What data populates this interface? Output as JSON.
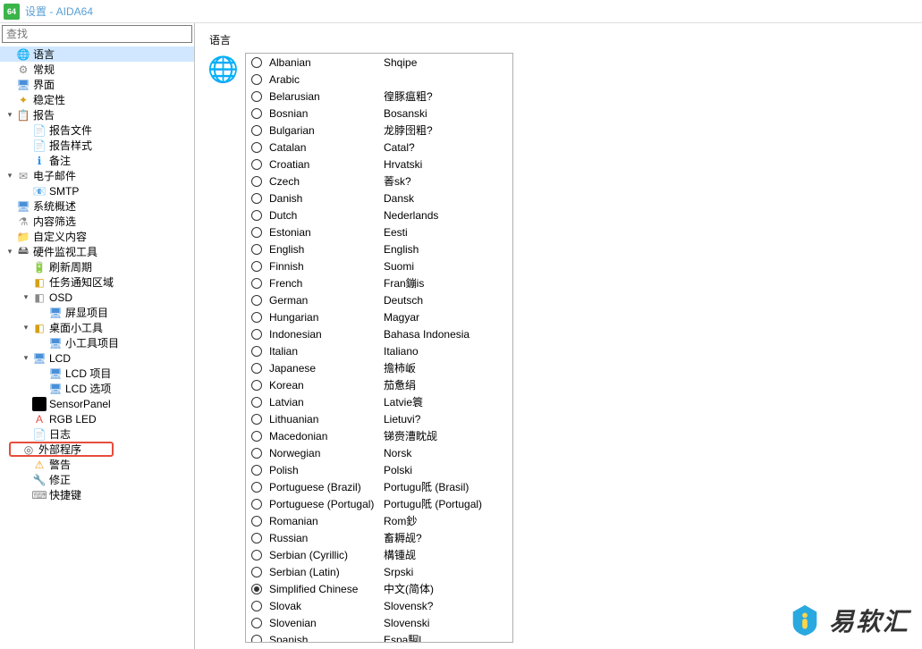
{
  "titlebar": {
    "icon_text": "64",
    "title": "设置 - AIDA64"
  },
  "search": {
    "placeholder": "查找"
  },
  "tree": [
    {
      "id": "language",
      "label": "语言",
      "icon": "🌐",
      "cls": "ic-globe",
      "indent": 0,
      "selected": true
    },
    {
      "id": "general",
      "label": "常规",
      "icon": "⚙",
      "cls": "ic-gear",
      "indent": 0
    },
    {
      "id": "interface",
      "label": "界面",
      "icon": "🖥",
      "cls": "ic-window",
      "indent": 0
    },
    {
      "id": "stability",
      "label": "稳定性",
      "icon": "✦",
      "cls": "ic-stable",
      "indent": 0
    },
    {
      "id": "report",
      "label": "报告",
      "icon": "📋",
      "cls": "ic-report",
      "indent": 0,
      "expander": "▾"
    },
    {
      "id": "report-file",
      "label": "报告文件",
      "icon": "📄",
      "cls": "ic-file",
      "indent": 1
    },
    {
      "id": "report-style",
      "label": "报告样式",
      "icon": "📄",
      "cls": "ic-file",
      "indent": 1
    },
    {
      "id": "remarks",
      "label": "备注",
      "icon": "ℹ",
      "cls": "ic-info",
      "indent": 1
    },
    {
      "id": "email",
      "label": "电子邮件",
      "icon": "✉",
      "cls": "ic-mail",
      "indent": 0,
      "expander": "▾"
    },
    {
      "id": "smtp",
      "label": "SMTP",
      "icon": "📧",
      "cls": "ic-mail",
      "indent": 1
    },
    {
      "id": "sysoverview",
      "label": "系统概述",
      "icon": "🖥",
      "cls": "ic-monitor",
      "indent": 0
    },
    {
      "id": "content-filter",
      "label": "内容筛选",
      "icon": "⚗",
      "cls": "ic-filter",
      "indent": 0
    },
    {
      "id": "custom",
      "label": "自定义内容",
      "icon": "📁",
      "cls": "ic-custom",
      "indent": 0
    },
    {
      "id": "hwmon",
      "label": "硬件监视工具",
      "icon": "🖴",
      "cls": "ic-hardware",
      "indent": 0,
      "expander": "▾"
    },
    {
      "id": "refresh",
      "label": "刷新周期",
      "icon": "🔋",
      "cls": "ic-battery",
      "indent": 1
    },
    {
      "id": "tray",
      "label": "任务通知区域",
      "icon": "◧",
      "cls": "ic-notify",
      "indent": 1
    },
    {
      "id": "osd",
      "label": "OSD",
      "icon": "◧",
      "cls": "ic-osd",
      "indent": 1,
      "expander": "▾"
    },
    {
      "id": "osd-item",
      "label": "屏显项目",
      "icon": "🖥",
      "cls": "ic-monitor",
      "indent": 2
    },
    {
      "id": "gadget",
      "label": "桌面小工具",
      "icon": "◧",
      "cls": "ic-widget",
      "indent": 1,
      "expander": "▾"
    },
    {
      "id": "gadget-item",
      "label": "小工具项目",
      "icon": "🖥",
      "cls": "ic-monitor",
      "indent": 2
    },
    {
      "id": "lcd",
      "label": "LCD",
      "icon": "🖥",
      "cls": "ic-lcd",
      "indent": 1,
      "expander": "▾"
    },
    {
      "id": "lcd-item",
      "label": "LCD 项目",
      "icon": "🖥",
      "cls": "ic-monitor",
      "indent": 2
    },
    {
      "id": "lcd-opt",
      "label": "LCD 选项",
      "icon": "🖥",
      "cls": "ic-monitor",
      "indent": 2
    },
    {
      "id": "sensorpanel",
      "label": "SensorPanel",
      "icon": "◼",
      "cls": "ic-sensor",
      "indent": 1
    },
    {
      "id": "rgbled",
      "label": "RGB LED",
      "icon": "A",
      "cls": "ic-rgb",
      "indent": 1
    },
    {
      "id": "log",
      "label": "日志",
      "icon": "📄",
      "cls": "ic-log",
      "indent": 1
    },
    {
      "id": "external",
      "label": "外部程序",
      "icon": "◎",
      "cls": "ic-ext",
      "indent": 1,
      "highlighted": true
    },
    {
      "id": "warning",
      "label": "警告",
      "icon": "⚠",
      "cls": "ic-warn",
      "indent": 1
    },
    {
      "id": "fix",
      "label": "修正",
      "icon": "🔧",
      "cls": "ic-fix",
      "indent": 1
    },
    {
      "id": "shortcut",
      "label": "快捷键",
      "icon": "⌨",
      "cls": "ic-key",
      "indent": 1
    }
  ],
  "main": {
    "section_title": "语言",
    "languages": [
      {
        "en": "Albanian",
        "native": "Shqipe"
      },
      {
        "en": "Arabic",
        "native": ""
      },
      {
        "en": "Belarusian",
        "native": "徨豚瘟粗?"
      },
      {
        "en": "Bosnian",
        "native": "Bosanski"
      },
      {
        "en": "Bulgarian",
        "native": "龙脖囹粗?"
      },
      {
        "en": "Catalan",
        "native": "Catal?"
      },
      {
        "en": "Croatian",
        "native": "Hrvatski"
      },
      {
        "en": "Czech",
        "native": "萫sk?"
      },
      {
        "en": "Danish",
        "native": "Dansk"
      },
      {
        "en": "Dutch",
        "native": "Nederlands"
      },
      {
        "en": "Estonian",
        "native": "Eesti"
      },
      {
        "en": "English",
        "native": "English"
      },
      {
        "en": "Finnish",
        "native": "Suomi"
      },
      {
        "en": "French",
        "native": "Fran鏰is"
      },
      {
        "en": "German",
        "native": "Deutsch"
      },
      {
        "en": "Hungarian",
        "native": "Magyar"
      },
      {
        "en": "Indonesian",
        "native": "Bahasa Indonesia"
      },
      {
        "en": "Italian",
        "native": "Italiano"
      },
      {
        "en": "Japanese",
        "native": "擔柿岅"
      },
      {
        "en": "Korean",
        "native": "茄惫绢"
      },
      {
        "en": "Latvian",
        "native": "Latvie簑"
      },
      {
        "en": "Lithuanian",
        "native": "Lietuvi?"
      },
      {
        "en": "Macedonian",
        "native": "锑赍漕眈觇"
      },
      {
        "en": "Norwegian",
        "native": "Norsk"
      },
      {
        "en": "Polish",
        "native": "Polski"
      },
      {
        "en": "Portuguese (Brazil)",
        "native": "Portugu阺 (Brasil)"
      },
      {
        "en": "Portuguese (Portugal)",
        "native": "Portugu阺 (Portugal)"
      },
      {
        "en": "Romanian",
        "native": "Rom鈔"
      },
      {
        "en": "Russian",
        "native": "畜耨觇?"
      },
      {
        "en": "Serbian (Cyrillic)",
        "native": "構锺觇"
      },
      {
        "en": "Serbian (Latin)",
        "native": "Srpski"
      },
      {
        "en": "Simplified Chinese",
        "native": "中文(简体)",
        "checked": true
      },
      {
        "en": "Slovak",
        "native": "Slovensk?"
      },
      {
        "en": "Slovenian",
        "native": "Slovenski"
      },
      {
        "en": "Spanish",
        "native": "Espa駉l"
      }
    ]
  },
  "watermark": {
    "text": "易软汇"
  }
}
